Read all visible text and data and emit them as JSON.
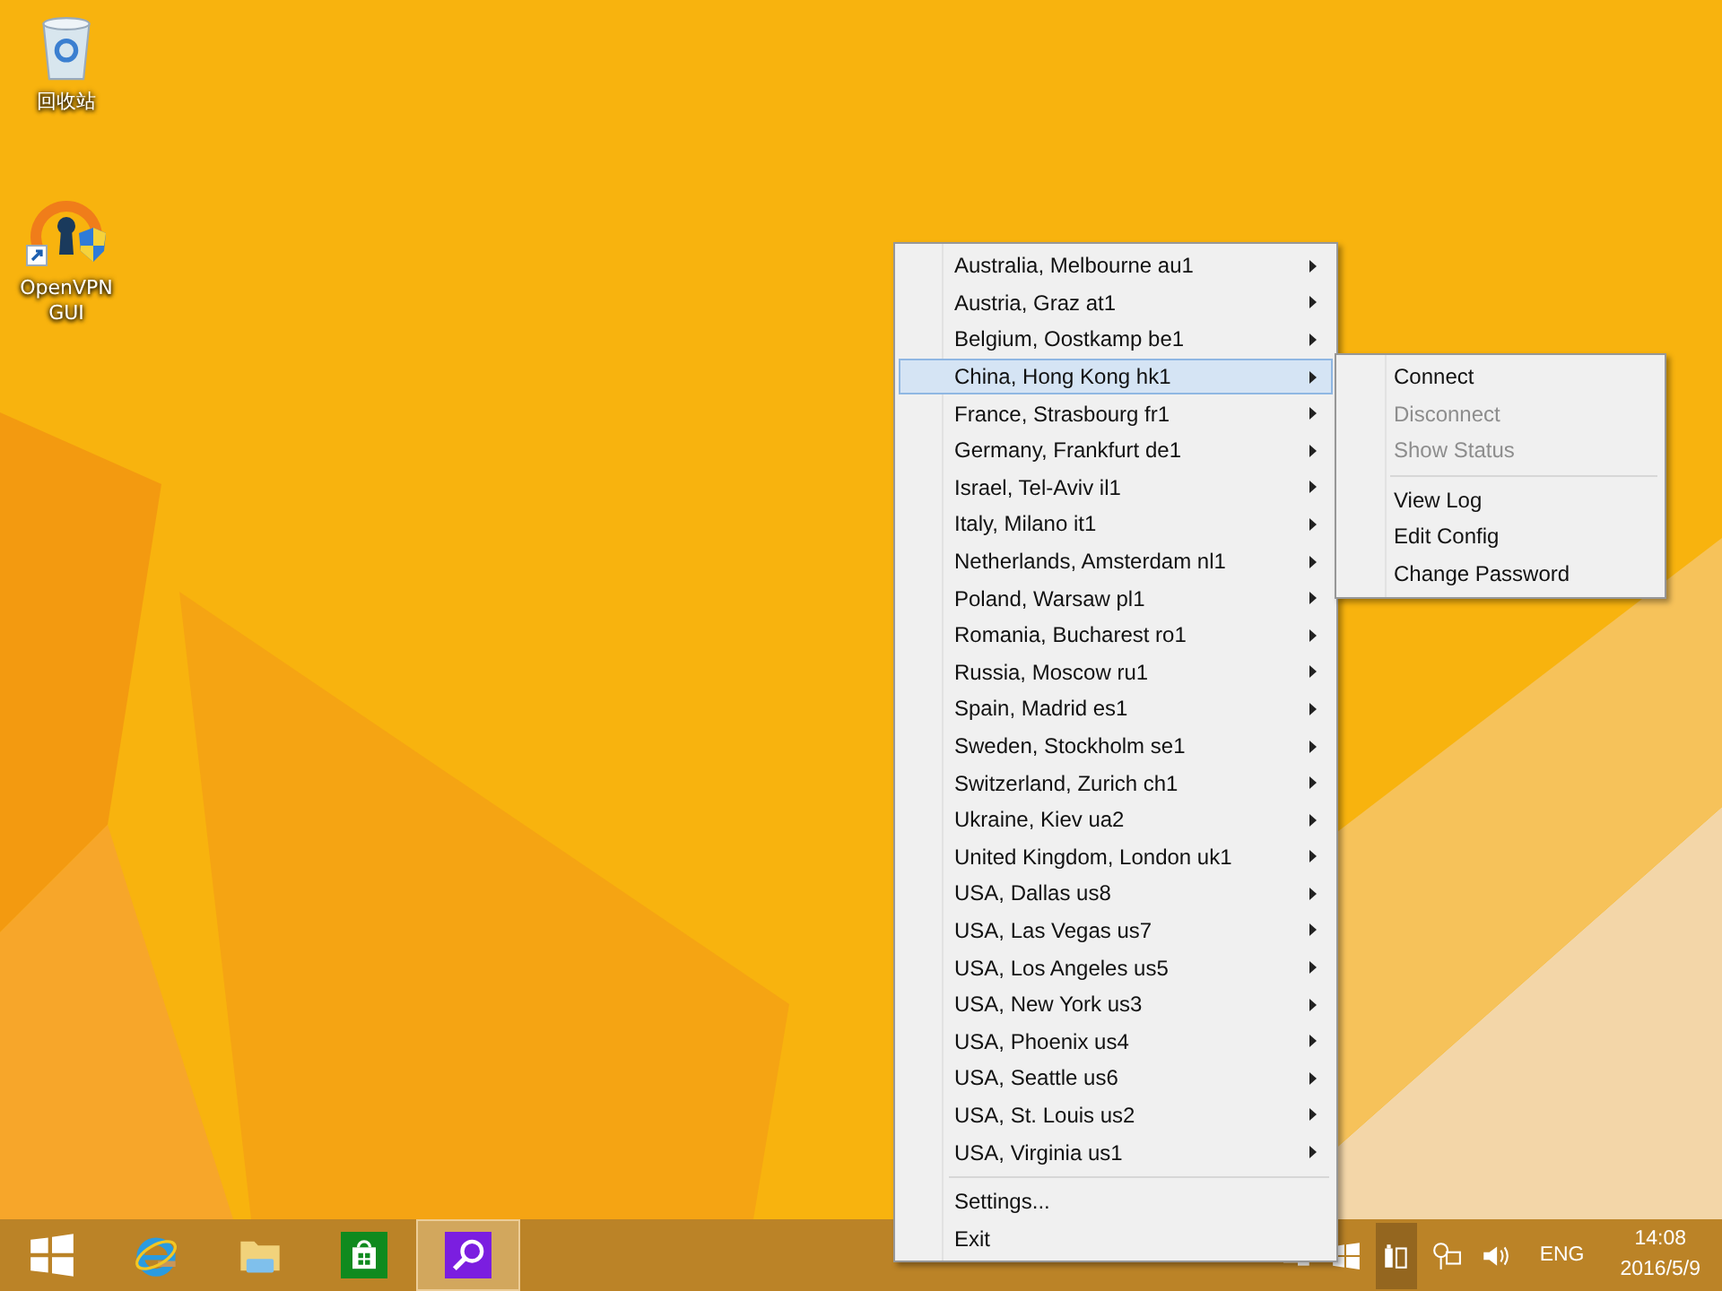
{
  "desktop_icons": [
    {
      "label": "回收站"
    },
    {
      "label": "OpenVPN GUI"
    }
  ],
  "menu": {
    "servers": [
      {
        "label": "Australia, Melbourne au1",
        "selected": false
      },
      {
        "label": "Austria, Graz at1",
        "selected": false
      },
      {
        "label": "Belgium, Oostkamp be1",
        "selected": false
      },
      {
        "label": "China, Hong Kong hk1",
        "selected": true
      },
      {
        "label": "France, Strasbourg fr1",
        "selected": false
      },
      {
        "label": "Germany, Frankfurt de1",
        "selected": false
      },
      {
        "label": "Israel, Tel-Aviv il1",
        "selected": false
      },
      {
        "label": "Italy, Milano it1",
        "selected": false
      },
      {
        "label": "Netherlands, Amsterdam nl1",
        "selected": false
      },
      {
        "label": "Poland, Warsaw pl1",
        "selected": false
      },
      {
        "label": "Romania, Bucharest ro1",
        "selected": false
      },
      {
        "label": "Russia, Moscow ru1",
        "selected": false
      },
      {
        "label": "Spain, Madrid es1",
        "selected": false
      },
      {
        "label": "Sweden, Stockholm se1",
        "selected": false
      },
      {
        "label": "Switzerland, Zurich ch1",
        "selected": false
      },
      {
        "label": "Ukraine, Kiev ua2",
        "selected": false
      },
      {
        "label": "United Kingdom, London uk1",
        "selected": false
      },
      {
        "label": "USA, Dallas us8",
        "selected": false
      },
      {
        "label": "USA, Las Vegas us7",
        "selected": false
      },
      {
        "label": "USA, Los Angeles us5",
        "selected": false
      },
      {
        "label": "USA, New York us3",
        "selected": false
      },
      {
        "label": "USA, Phoenix us4",
        "selected": false
      },
      {
        "label": "USA, Seattle us6",
        "selected": false
      },
      {
        "label": "USA, St. Louis us2",
        "selected": false
      },
      {
        "label": "USA, Virginia us1",
        "selected": false
      }
    ],
    "bottom_items": [
      {
        "label": "Settings..."
      },
      {
        "label": "Exit"
      }
    ]
  },
  "submenu": {
    "groups": [
      [
        {
          "label": "Connect",
          "disabled": false
        },
        {
          "label": "Disconnect",
          "disabled": true
        },
        {
          "label": "Show Status",
          "disabled": true
        }
      ],
      [
        {
          "label": "View Log",
          "disabled": false
        },
        {
          "label": "Edit Config",
          "disabled": false
        },
        {
          "label": "Change Password",
          "disabled": false
        }
      ]
    ]
  },
  "taskbar": {
    "pinned": [
      {
        "selected": false
      },
      {
        "selected": false
      },
      {
        "selected": false
      },
      {
        "selected": false
      },
      {
        "selected": true
      }
    ],
    "language": "ENG",
    "time": "14:08",
    "date": "2016/5/9"
  }
}
